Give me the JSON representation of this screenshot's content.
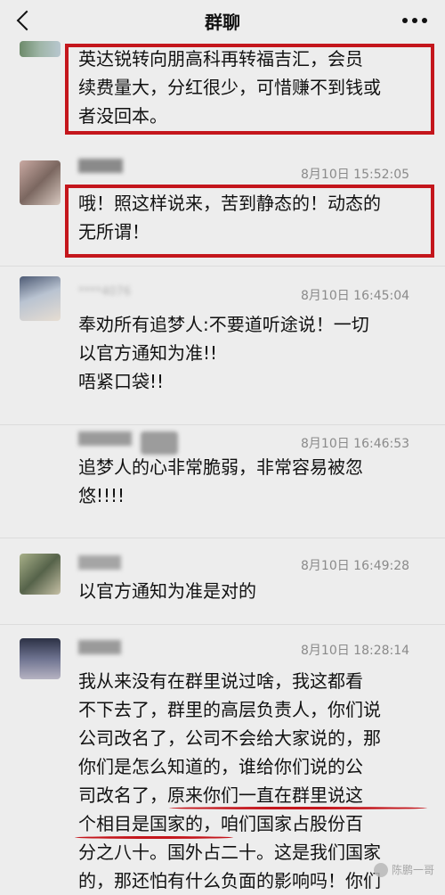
{
  "header": {
    "title": "群聊"
  },
  "messages": [
    {
      "id": "m0",
      "text": [
        "英达锐转向朋高科再转福吉汇，会员",
        "续费量大，分红很少，可惜赚不到钱或",
        "者没回本。"
      ]
    },
    {
      "id": "m1",
      "time": "8月10日 15:52:05",
      "text": [
        "哦！照这样说来，苦到静态的！动态的",
        "无所谓！"
      ]
    },
    {
      "id": "m2",
      "sender": "****4076",
      "time": "8月10日 16:45:04",
      "text": [
        "奉劝所有追梦人:不要道听途说！一切",
        "以官方通知为准!!",
        " 唔紧口袋!!"
      ]
    },
    {
      "id": "m3",
      "time": "8月10日 16:46:53",
      "text": [
        "追梦人的心非常脆弱，非常容易被忽",
        "悠!!!!"
      ]
    },
    {
      "id": "m4",
      "time": "8月10日 16:49:28",
      "text": [
        "以官方通知为准是对的"
      ]
    },
    {
      "id": "m5",
      "time": "8月10日 18:28:14",
      "text": [
        "我从来没有在群里说过啥，我这都看",
        "不下去了，群里的高层负责人，你们说",
        "公司改名了，公司不会给大家说的，那",
        "你们是怎么知道的，谁给你们说的公",
        "司改名了，原来你们一直在群里说这",
        "个相目是国家的，咱们国家占股份百",
        "分之八十。国外占二十。这是我们国家",
        "的，那还怕有什么负面的影响吗！你们"
      ]
    }
  ],
  "watermark": "陈鹏一哥",
  "colors": {
    "highlight": "#c4161c",
    "background": "#ededed"
  }
}
